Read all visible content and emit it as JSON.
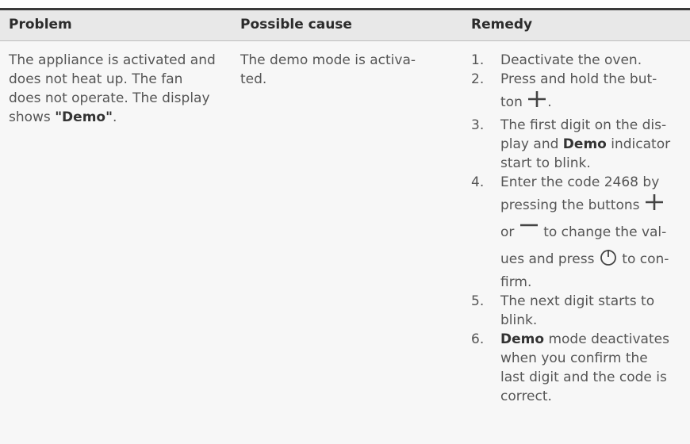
{
  "header": {
    "problem": "Problem",
    "cause": "Possible cause",
    "remedy": "Remedy"
  },
  "row": {
    "problem_text": "The appliance is activated and does not heat up. The fan does not operate. The display shows ",
    "problem_bold": "\"Demo\"",
    "problem_end": ".",
    "cause_line1": "The demo mode is activa-",
    "cause_line2": "ted.",
    "steps": {
      "s1": {
        "num": "1.",
        "text": "Deactivate the oven."
      },
      "s2": {
        "num": "2.",
        "l1": "Press and hold the but-",
        "l2": "ton",
        "l2_end": "."
      },
      "s3": {
        "num": "3.",
        "l1": "The first digit on the dis-",
        "l2a": "play and ",
        "l2b": "Demo",
        "l2c": " indicator",
        "l3": "start to blink."
      },
      "s4": {
        "num": "4.",
        "l1": "Enter the code 2468 by",
        "l2": "pressing the buttons ",
        "l3a": "or ",
        "l3b": " to change the val-",
        "l4a": "ues and press ",
        "l4b": " to con-",
        "l5": "firm."
      },
      "s5": {
        "num": "5.",
        "l1": "The next digit starts to",
        "l2": "blink."
      },
      "s6": {
        "num": "6.",
        "l1a": "Demo",
        "l1b": " mode deactivates",
        "l2": "when you confirm the",
        "l3": "last digit and the code is",
        "l4": "correct."
      }
    }
  },
  "icons": [
    "plus-icon",
    "minus-icon",
    "power-icon"
  ]
}
